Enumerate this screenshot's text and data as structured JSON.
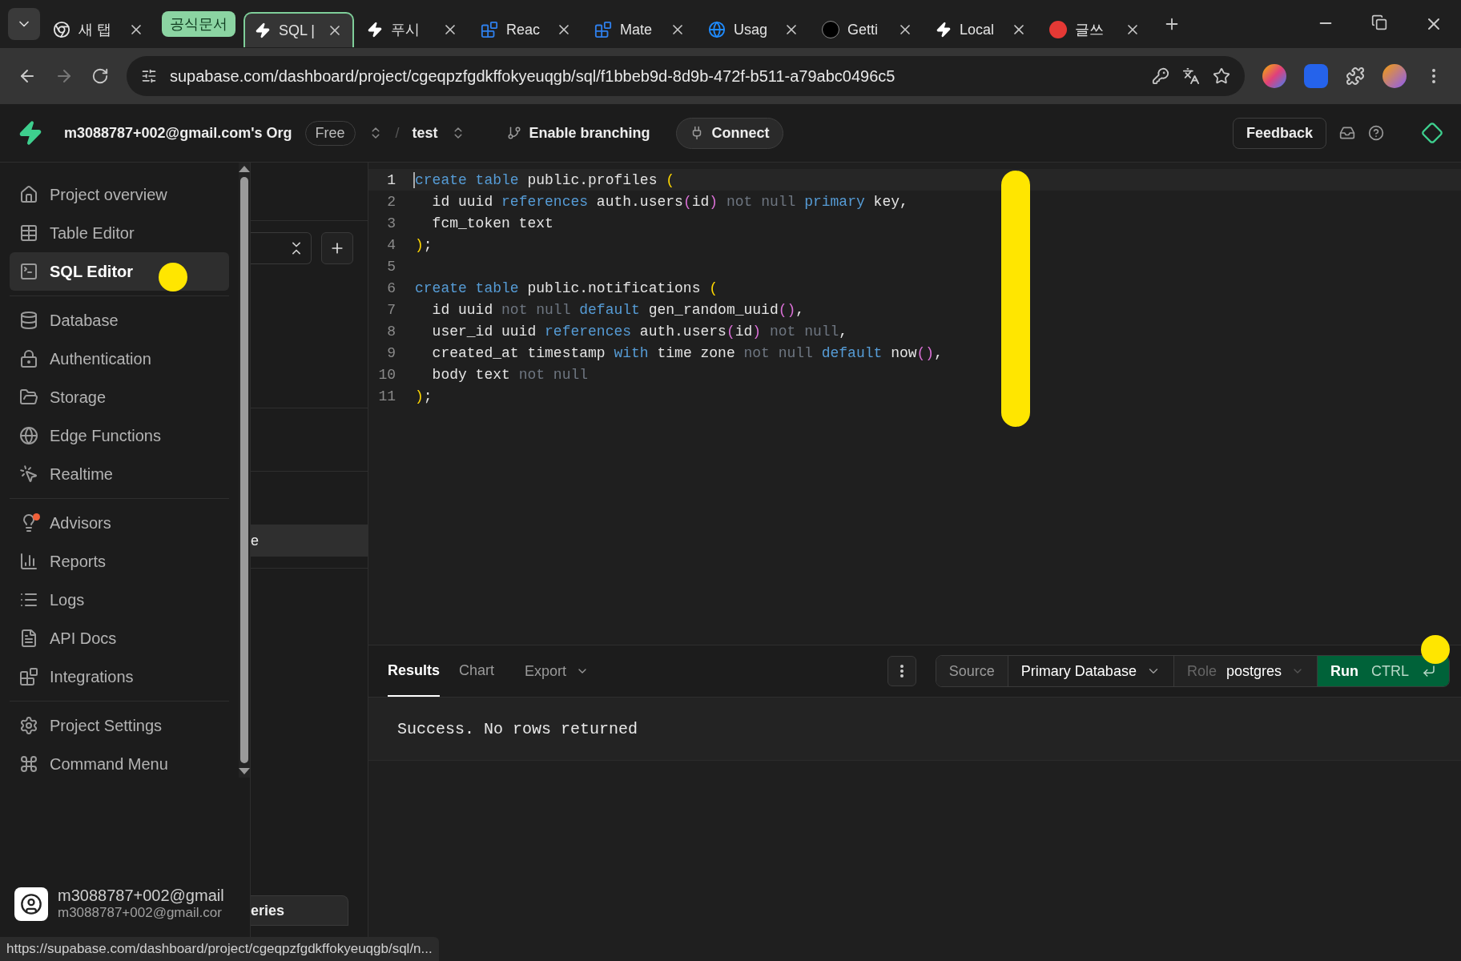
{
  "browser": {
    "tab_group": "공식문서",
    "tabs": [
      {
        "label": "새 탭",
        "selected": false
      },
      {
        "label": "SQL |",
        "selected": true
      },
      {
        "label": "푸시",
        "selected": false
      },
      {
        "label": "Reac",
        "selected": false
      },
      {
        "label": "Mate",
        "selected": false
      },
      {
        "label": "Usag",
        "selected": false
      },
      {
        "label": "Getti",
        "selected": false
      },
      {
        "label": "Local",
        "selected": false
      },
      {
        "label": "글쓰",
        "selected": false
      }
    ],
    "address": "supabase.com/dashboard/project/cgeqpzfgdkffokyeuqgb/sql/f1bbeb9d-8d9b-472f-b511-a79abc0496c5",
    "status_url": "https://supabase.com/dashboard/project/cgeqpzfgdkffokyeuqgb/sql/n..."
  },
  "header": {
    "org": "m3088787+002@gmail.com's Org",
    "plan": "Free",
    "separator": "/",
    "project": "test",
    "branching": "Enable branching",
    "connect": "Connect",
    "feedback": "Feedback"
  },
  "sidebar": {
    "groups": [
      [
        {
          "label": "Project overview",
          "selected": false
        },
        {
          "label": "Table Editor",
          "selected": false
        },
        {
          "label": "SQL Editor",
          "selected": true
        }
      ],
      [
        {
          "label": "Database",
          "selected": false
        },
        {
          "label": "Authentication",
          "selected": false
        },
        {
          "label": "Storage",
          "selected": false
        },
        {
          "label": "Edge Functions",
          "selected": false
        },
        {
          "label": "Realtime",
          "selected": false
        }
      ],
      [
        {
          "label": "Advisors",
          "selected": false
        },
        {
          "label": "Reports",
          "selected": false
        },
        {
          "label": "Logs",
          "selected": false
        },
        {
          "label": "API Docs",
          "selected": false
        },
        {
          "label": "Integrations",
          "selected": false
        }
      ],
      [
        {
          "label": "Project Settings",
          "selected": false
        },
        {
          "label": "Command Menu",
          "selected": false
        }
      ]
    ],
    "user": {
      "name": "m3088787+002@gmail",
      "email": "m3088787+002@gmail.cor"
    }
  },
  "queries_panel": {
    "selected_row": "e",
    "bottom_button": "eries"
  },
  "editor": {
    "lines": [
      {
        "number": "1",
        "tokens": [
          {
            "text": "create table",
            "kind": "keyword"
          },
          {
            "text": " public.profiles ",
            "kind": "plain"
          },
          {
            "text": "(",
            "kind": "bracket"
          }
        ]
      },
      {
        "number": "2",
        "tokens": [
          {
            "text": "  id uuid ",
            "kind": "plain"
          },
          {
            "text": "references",
            "kind": "keyword"
          },
          {
            "text": " auth.users",
            "kind": "plain"
          },
          {
            "text": "(",
            "kind": "paren"
          },
          {
            "text": "id",
            "kind": "plain"
          },
          {
            "text": ")",
            "kind": "paren"
          },
          {
            "text": " not null ",
            "kind": "muted"
          },
          {
            "text": "primary",
            "kind": "keyword"
          },
          {
            "text": " key,",
            "kind": "plain"
          }
        ]
      },
      {
        "number": "3",
        "tokens": [
          {
            "text": "  fcm_token text",
            "kind": "plain"
          }
        ]
      },
      {
        "number": "4",
        "tokens": [
          {
            "text": ")",
            "kind": "bracket"
          },
          {
            "text": ";",
            "kind": "plain"
          }
        ]
      },
      {
        "number": "5"
      },
      {
        "number": "6",
        "tokens": [
          {
            "text": "create table",
            "kind": "keyword"
          },
          {
            "text": " public.notifications ",
            "kind": "plain"
          },
          {
            "text": "(",
            "kind": "bracket"
          }
        ]
      },
      {
        "number": "7",
        "tokens": [
          {
            "text": "  id uuid ",
            "kind": "plain"
          },
          {
            "text": "not null ",
            "kind": "muted"
          },
          {
            "text": "default",
            "kind": "keyword"
          },
          {
            "text": " gen_random_uuid",
            "kind": "plain"
          },
          {
            "text": "()",
            "kind": "paren"
          },
          {
            "text": ",",
            "kind": "plain"
          }
        ]
      },
      {
        "number": "8",
        "tokens": [
          {
            "text": "  user_id uuid ",
            "kind": "plain"
          },
          {
            "text": "references",
            "kind": "keyword"
          },
          {
            "text": " auth.users",
            "kind": "plain"
          },
          {
            "text": "(",
            "kind": "paren"
          },
          {
            "text": "id",
            "kind": "plain"
          },
          {
            "text": ")",
            "kind": "paren"
          },
          {
            "text": " not null",
            "kind": "muted"
          },
          {
            "text": ",",
            "kind": "plain"
          }
        ]
      },
      {
        "number": "9",
        "tokens": [
          {
            "text": "  created_at timestamp ",
            "kind": "plain"
          },
          {
            "text": "with",
            "kind": "keyword"
          },
          {
            "text": " time zone ",
            "kind": "plain"
          },
          {
            "text": "not null ",
            "kind": "muted"
          },
          {
            "text": "default",
            "kind": "keyword"
          },
          {
            "text": " now",
            "kind": "plain"
          },
          {
            "text": "()",
            "kind": "paren"
          },
          {
            "text": ",",
            "kind": "plain"
          }
        ]
      },
      {
        "number": "10",
        "tokens": [
          {
            "text": "  body text ",
            "kind": "plain"
          },
          {
            "text": "not null",
            "kind": "muted"
          }
        ]
      },
      {
        "number": "11",
        "tokens": [
          {
            "text": ")",
            "kind": "bracket"
          },
          {
            "text": ";",
            "kind": "plain"
          }
        ]
      }
    ]
  },
  "results": {
    "tabs": [
      {
        "label": "Results",
        "selected": true
      },
      {
        "label": "Chart",
        "selected": false
      }
    ],
    "export": "Export",
    "source_label": "Source",
    "source": "Primary Database",
    "role_label": "Role",
    "role": "postgres",
    "run": "Run",
    "shortcut": "CTRL",
    "message": "Success. No rows returned"
  }
}
